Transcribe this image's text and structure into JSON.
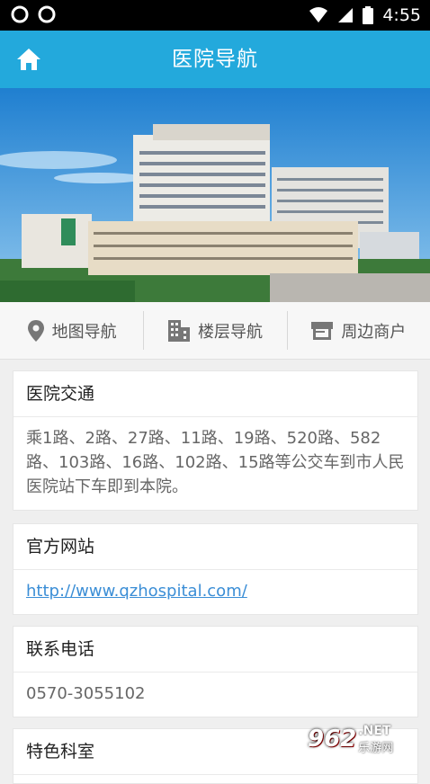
{
  "status_bar": {
    "time": "4:55"
  },
  "app_bar": {
    "title": "医院导航"
  },
  "tabs": [
    {
      "label": "地图导航",
      "icon": "map-pin-icon"
    },
    {
      "label": "楼层导航",
      "icon": "building-icon"
    },
    {
      "label": "周边商户",
      "icon": "store-icon"
    }
  ],
  "cards": {
    "traffic": {
      "title": "医院交通",
      "body": "乘1路、2路、27路、11路、19路、520路、582路、103路、16路、102路、15路等公交车到市人民医院站下车即到本院。"
    },
    "website": {
      "title": "官方网站",
      "url": "http://www.qzhospital.com/"
    },
    "phone": {
      "title": "联系电话",
      "number": "0570-3055102"
    },
    "specialty": {
      "title": "特色科室"
    }
  },
  "watermark": {
    "number": "962",
    "suffix": ".NET",
    "sub": "乐游网"
  },
  "colors": {
    "app_bar": "#23a9dc",
    "link": "#3b8ed6"
  }
}
